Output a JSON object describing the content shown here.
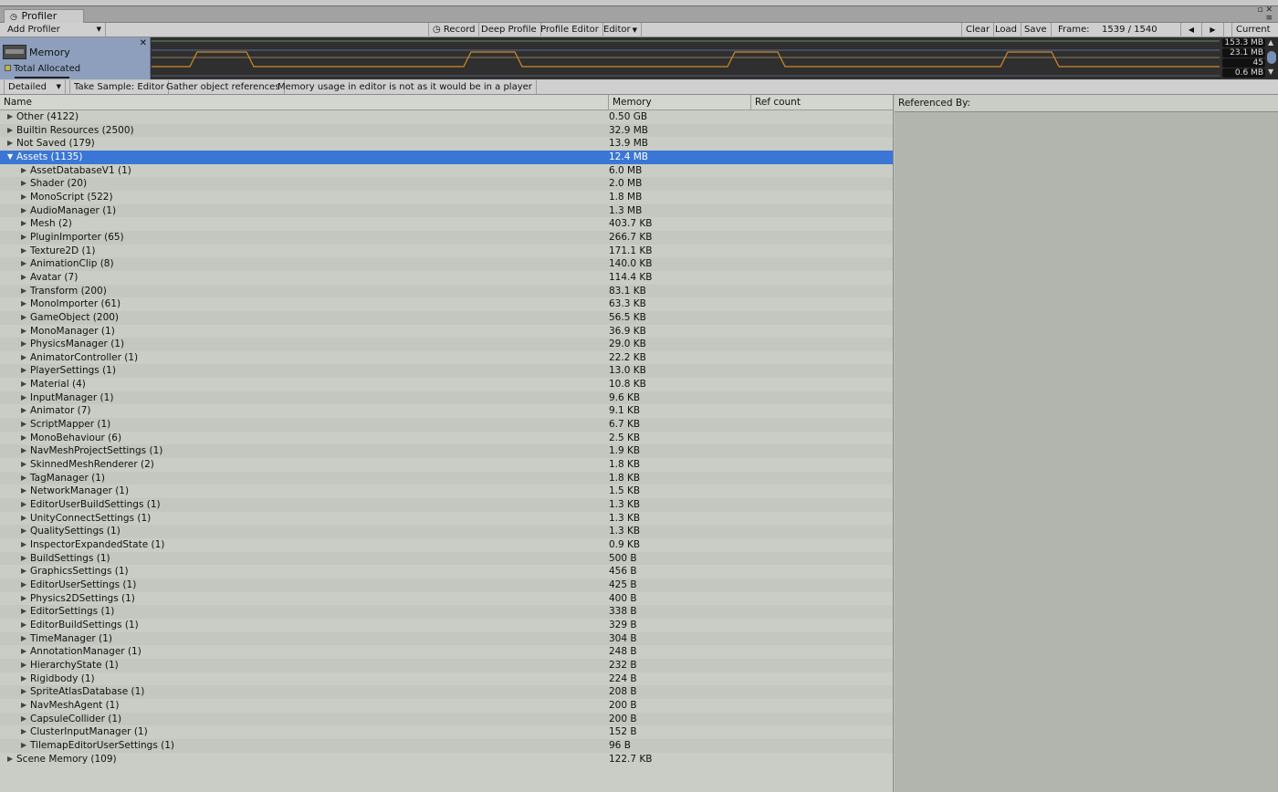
{
  "window": {
    "tab_title": "Profiler",
    "tab_icon": "profiler-icon",
    "menu_icon": "≡"
  },
  "toolbar": {
    "add_profiler": "Add Profiler",
    "record": "Record",
    "deep_profile": "Deep Profile",
    "profile_editor": "Profile Editor",
    "editor": "Editor",
    "clear": "Clear",
    "load": "Load",
    "save": "Save",
    "frame_label": "Frame:",
    "frame_value": "1539 / 1540",
    "current": "Current"
  },
  "graph": {
    "module": "Memory",
    "legend": "Total Allocated",
    "legend_color": "#c0b44a",
    "line_color": "#d08a28",
    "labels": [
      "153.3 MB",
      "23.1 MB",
      "45",
      "0.6 MB"
    ]
  },
  "subbar": {
    "mode": "Detailed",
    "take_sample": "Take Sample: Editor",
    "gather": "Gather object references",
    "note": "Memory usage in editor is not as it would be in a player"
  },
  "columns": {
    "name": "Name",
    "memory": "Memory",
    "ref_count": "Ref count"
  },
  "referenced_by": "Referenced By:",
  "rows": [
    {
      "name": "Other (4122)",
      "memory": "0.50 GB",
      "level": 0,
      "expanded": false
    },
    {
      "name": "Builtin Resources (2500)",
      "memory": "32.9 MB",
      "level": 0,
      "expanded": false
    },
    {
      "name": "Not Saved (179)",
      "memory": "13.9 MB",
      "level": 0,
      "expanded": false
    },
    {
      "name": "Assets (1135)",
      "memory": "12.4 MB",
      "level": 0,
      "expanded": true,
      "selected": true
    },
    {
      "name": "AssetDatabaseV1 (1)",
      "memory": "6.0 MB",
      "level": 1
    },
    {
      "name": "Shader (20)",
      "memory": "2.0 MB",
      "level": 1
    },
    {
      "name": "MonoScript (522)",
      "memory": "1.8 MB",
      "level": 1
    },
    {
      "name": "AudioManager (1)",
      "memory": "1.3 MB",
      "level": 1
    },
    {
      "name": "Mesh (2)",
      "memory": "403.7 KB",
      "level": 1
    },
    {
      "name": "PluginImporter (65)",
      "memory": "266.7 KB",
      "level": 1
    },
    {
      "name": "Texture2D (1)",
      "memory": "171.1 KB",
      "level": 1
    },
    {
      "name": "AnimationClip (8)",
      "memory": "140.0 KB",
      "level": 1
    },
    {
      "name": "Avatar (7)",
      "memory": "114.4 KB",
      "level": 1
    },
    {
      "name": "Transform (200)",
      "memory": "83.1 KB",
      "level": 1
    },
    {
      "name": "MonoImporter (61)",
      "memory": "63.3 KB",
      "level": 1
    },
    {
      "name": "GameObject (200)",
      "memory": "56.5 KB",
      "level": 1
    },
    {
      "name": "MonoManager (1)",
      "memory": "36.9 KB",
      "level": 1
    },
    {
      "name": "PhysicsManager (1)",
      "memory": "29.0 KB",
      "level": 1
    },
    {
      "name": "AnimatorController (1)",
      "memory": "22.2 KB",
      "level": 1
    },
    {
      "name": "PlayerSettings (1)",
      "memory": "13.0 KB",
      "level": 1
    },
    {
      "name": "Material (4)",
      "memory": "10.8 KB",
      "level": 1
    },
    {
      "name": "InputManager (1)",
      "memory": "9.6 KB",
      "level": 1
    },
    {
      "name": "Animator (7)",
      "memory": "9.1 KB",
      "level": 1
    },
    {
      "name": "ScriptMapper (1)",
      "memory": "6.7 KB",
      "level": 1
    },
    {
      "name": "MonoBehaviour (6)",
      "memory": "2.5 KB",
      "level": 1
    },
    {
      "name": "NavMeshProjectSettings (1)",
      "memory": "1.9 KB",
      "level": 1
    },
    {
      "name": "SkinnedMeshRenderer (2)",
      "memory": "1.8 KB",
      "level": 1
    },
    {
      "name": "TagManager (1)",
      "memory": "1.8 KB",
      "level": 1
    },
    {
      "name": "NetworkManager (1)",
      "memory": "1.5 KB",
      "level": 1
    },
    {
      "name": "EditorUserBuildSettings (1)",
      "memory": "1.3 KB",
      "level": 1
    },
    {
      "name": "UnityConnectSettings (1)",
      "memory": "1.3 KB",
      "level": 1
    },
    {
      "name": "QualitySettings (1)",
      "memory": "1.3 KB",
      "level": 1
    },
    {
      "name": "InspectorExpandedState (1)",
      "memory": "0.9 KB",
      "level": 1
    },
    {
      "name": "BuildSettings (1)",
      "memory": "500 B",
      "level": 1
    },
    {
      "name": "GraphicsSettings (1)",
      "memory": "456 B",
      "level": 1
    },
    {
      "name": "EditorUserSettings (1)",
      "memory": "425 B",
      "level": 1
    },
    {
      "name": "Physics2DSettings (1)",
      "memory": "400 B",
      "level": 1
    },
    {
      "name": "EditorSettings (1)",
      "memory": "338 B",
      "level": 1
    },
    {
      "name": "EditorBuildSettings (1)",
      "memory": "329 B",
      "level": 1
    },
    {
      "name": "TimeManager (1)",
      "memory": "304 B",
      "level": 1
    },
    {
      "name": "AnnotationManager (1)",
      "memory": "248 B",
      "level": 1
    },
    {
      "name": "HierarchyState (1)",
      "memory": "232 B",
      "level": 1
    },
    {
      "name": "Rigidbody (1)",
      "memory": "224 B",
      "level": 1
    },
    {
      "name": "SpriteAtlasDatabase (1)",
      "memory": "208 B",
      "level": 1
    },
    {
      "name": "NavMeshAgent (1)",
      "memory": "200 B",
      "level": 1
    },
    {
      "name": "CapsuleCollider (1)",
      "memory": "200 B",
      "level": 1
    },
    {
      "name": "ClusterInputManager (1)",
      "memory": "152 B",
      "level": 1
    },
    {
      "name": "TilemapEditorUserSettings (1)",
      "memory": "96 B",
      "level": 1
    },
    {
      "name": "Scene Memory (109)",
      "memory": "122.7 KB",
      "level": 0,
      "expanded": false
    }
  ]
}
